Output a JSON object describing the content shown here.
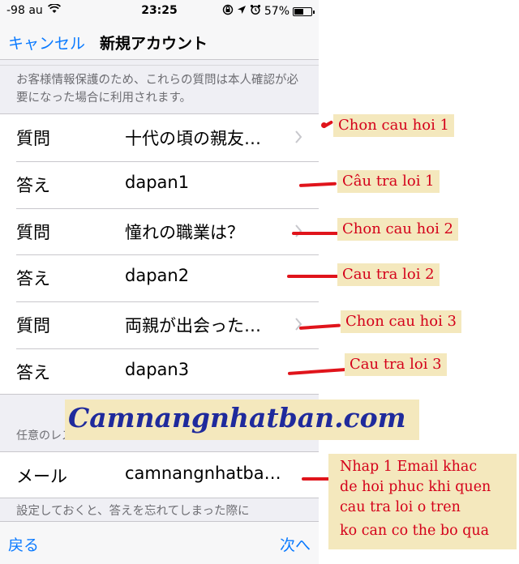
{
  "status_bar": {
    "signal": "-98 au",
    "time": "23:25",
    "battery_percent": "57%",
    "battery_level": 0.57
  },
  "nav": {
    "cancel_label": "キャンセル",
    "title": "新規アカウント"
  },
  "top_note": "お客様情報保護のため、これらの質問は本人確認が必要になった場合に利用されます。",
  "rows": [
    {
      "label": "質問",
      "value": "十代の頃の親友…"
    },
    {
      "label": "答え",
      "value": "dapan1"
    },
    {
      "label": "質問",
      "value": "憧れの職業は？"
    },
    {
      "label": "答え",
      "value": "dapan2"
    },
    {
      "label": "質問",
      "value": "両親が出会った…"
    },
    {
      "label": "答え",
      "value": "dapan3"
    }
  ],
  "rescue_section": {
    "header": "任意のレスキューメール",
    "mail_label": "メール",
    "mail_value": "camnangnhatba…",
    "footer_note": "設定しておくと、答えを忘れてしまった際に"
  },
  "toolbar": {
    "back_label": "戻る",
    "next_label": "次へ"
  },
  "annotations": [
    "Chon cau hoi 1",
    "Câu tra loi 1",
    "Chon cau hoi 2",
    "Cau tra loi 2",
    "Chon cau hoi 3",
    "Cau tra loi 3"
  ],
  "email_annotation": [
    "Nhap 1 Email khac",
    "de hoi phuc khi quen",
    "cau tra loi o tren",
    "ko can co the bo qua"
  ],
  "watermark": "Camnangnhatban.com",
  "colors": {
    "ios_blue": "#0a7aff",
    "annotation_red": "#e0141b",
    "annotation_bg": "#f4e8bd",
    "watermark_blue": "#1f2a9c"
  }
}
